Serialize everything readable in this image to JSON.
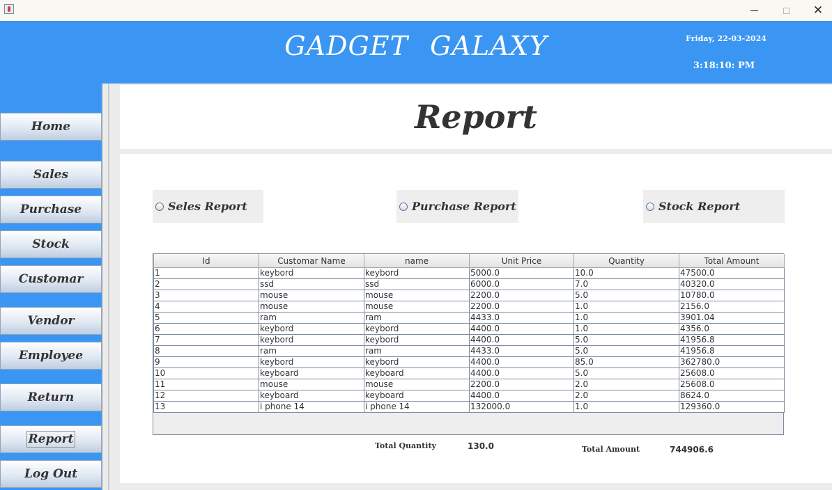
{
  "window": {
    "minimize": "—",
    "maximize": "☐",
    "close": "✕"
  },
  "header": {
    "brand": "GADGET  GALAXY",
    "date": "Friday, 22-03-2024",
    "time": "3:18:10: PM"
  },
  "sidebar": {
    "items": [
      {
        "label": "Home"
      },
      {
        "label": "Sales"
      },
      {
        "label": "Purchase"
      },
      {
        "label": "Stock"
      },
      {
        "label": "Customar"
      },
      {
        "label": "Vendor"
      },
      {
        "label": "Employee"
      },
      {
        "label": "Return"
      },
      {
        "label": "Report"
      },
      {
        "label": "Log Out"
      }
    ]
  },
  "page": {
    "title": "Report"
  },
  "options": {
    "sales": "Seles Report",
    "purchase": "Purchase Report",
    "stock": "Stock Report"
  },
  "table": {
    "columns": [
      "Id",
      "Customar Name",
      "name",
      "Unit Price",
      "Quantity",
      "Total Amount"
    ],
    "rows": [
      [
        "1",
        "keybord",
        "keybord",
        "5000.0",
        "10.0",
        "47500.0"
      ],
      [
        "2",
        "ssd",
        "ssd",
        "6000.0",
        "7.0",
        "40320.0"
      ],
      [
        "3",
        "mouse",
        "mouse",
        "2200.0",
        "5.0",
        "10780.0"
      ],
      [
        "4",
        "mouse",
        "mouse",
        "2200.0",
        "1.0",
        "2156.0"
      ],
      [
        "5",
        "ram",
        "ram",
        "4433.0",
        "1.0",
        "3901.04"
      ],
      [
        "6",
        "keybord",
        "keybord",
        "4400.0",
        "1.0",
        "4356.0"
      ],
      [
        "7",
        "keybord",
        "keybord",
        "4400.0",
        "5.0",
        "41956.8"
      ],
      [
        "8",
        "ram",
        "ram",
        "4433.0",
        "5.0",
        "41956.8"
      ],
      [
        "9",
        "keybord",
        "keybord",
        "4400.0",
        "85.0",
        "362780.0"
      ],
      [
        "10",
        "keyboard",
        "keyboard",
        "4400.0",
        "5.0",
        "25608.0"
      ],
      [
        "11",
        "mouse",
        "mouse",
        "2200.0",
        "2.0",
        "25608.0"
      ],
      [
        "12",
        "keyboard",
        "keyboard",
        "4400.0",
        "2.0",
        "8624.0"
      ],
      [
        "13",
        "i phone 14",
        "i phone 14",
        "132000.0",
        "1.0",
        "129360.0"
      ]
    ]
  },
  "totals": {
    "quantity_label": "Total  Quantity",
    "quantity_value": "130.0",
    "amount_label": "Total  Amount",
    "amount_value": "744906.6"
  }
}
